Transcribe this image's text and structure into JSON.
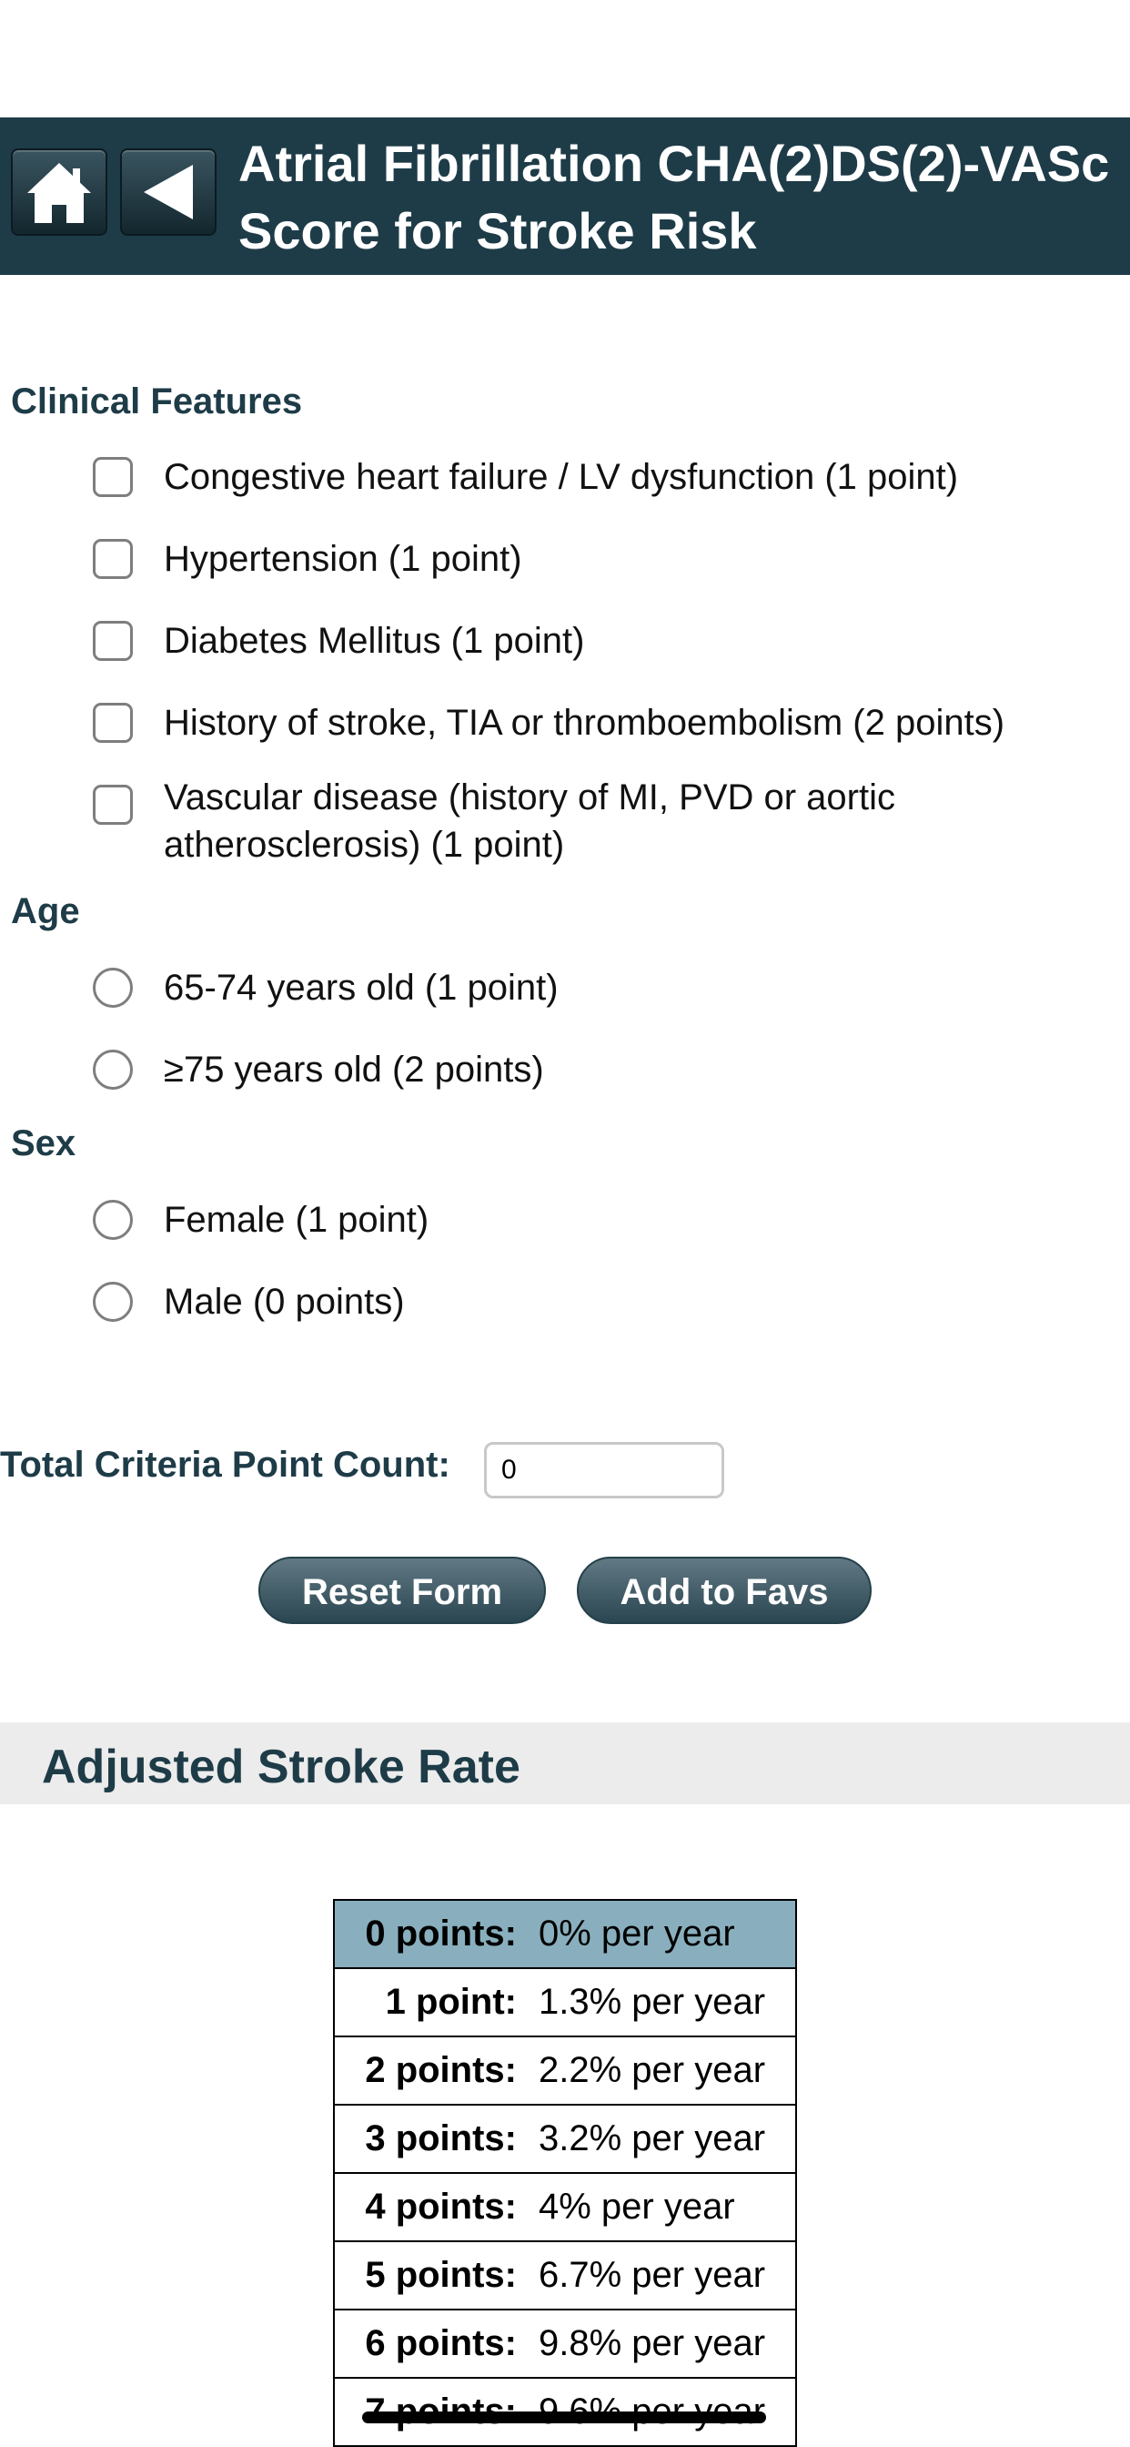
{
  "header": {
    "title": "Atrial Fibrillation CHA(2)DS(2)-VASc Score for Stroke Risk"
  },
  "sections": {
    "clinical": {
      "label": "Clinical Features",
      "items": [
        "Congestive heart failure / LV dysfunction (1 point)",
        "Hypertension (1 point)",
        "Diabetes Mellitus (1 point)",
        "History of stroke, TIA or thromboembolism (2 points)",
        "Vascular disease (history of MI, PVD or aortic atherosclerosis) (1 point)"
      ]
    },
    "age": {
      "label": "Age",
      "items": [
        "65-74 years old (1 point)",
        "≥75 years old (2 points)"
      ]
    },
    "sex": {
      "label": "Sex",
      "items": [
        "Female (1 point)",
        "Male (0 points)"
      ]
    }
  },
  "total": {
    "label": "Total Criteria Point Count:",
    "value": "0"
  },
  "buttons": {
    "reset": "Reset Form",
    "favs": "Add to Favs"
  },
  "rates": {
    "title": "Adjusted Stroke Rate",
    "rows": [
      {
        "points": "0 points:",
        "rate": "0% per year"
      },
      {
        "points": "1 point:",
        "rate": "1.3% per year"
      },
      {
        "points": "2 points:",
        "rate": "2.2% per year"
      },
      {
        "points": "3 points:",
        "rate": "3.2% per year"
      },
      {
        "points": "4 points:",
        "rate": "4% per year"
      },
      {
        "points": "5 points:",
        "rate": "6.7% per year"
      },
      {
        "points": "6 points:",
        "rate": "9.8% per year"
      },
      {
        "points": "7 points:",
        "rate": "9.6% per year"
      }
    ]
  },
  "colors": {
    "header_bg": "#1e3c48",
    "accent_text": "#1e3c48",
    "highlight_row": "#89afbe",
    "section_band": "#ececec"
  },
  "icons": [
    "home-icon",
    "back-arrow-icon"
  ]
}
